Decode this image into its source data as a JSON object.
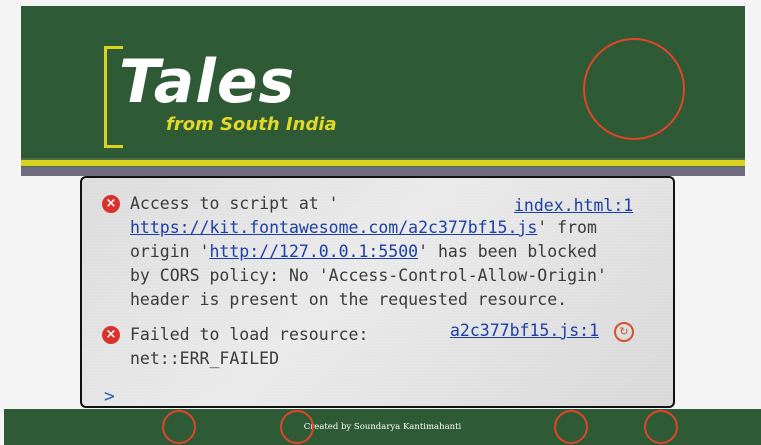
{
  "header": {
    "logo_title": "Tales",
    "logo_subtitle": "from South India"
  },
  "console": {
    "message1": {
      "line1_text": "Access to script at '",
      "source": "index.html:1",
      "url": "https://kit.fontawesome.com/a2c377bf15.js",
      "line2_suffix": "' from",
      "line3_prefix": "origin '",
      "origin": "http://127.0.0.1:5500",
      "line3_suffix": "' has been blocked",
      "line4": "by CORS policy: No 'Access-Control-Allow-Origin'",
      "line5": "header is present on the requested resource."
    },
    "message2": {
      "line1_text": "Failed to load resource:",
      "source": "a2c377bf15.js:1",
      "line2": "net::ERR_FAILED"
    },
    "prompt": ">",
    "error_icon": "error-circle-icon",
    "warning_icon": "swirl-icon"
  },
  "footer": {
    "credit": "Created by Soundarya Kantimahanti"
  },
  "colors": {
    "green": "#2f5a36",
    "yellow": "#d9d31f",
    "annotation_red": "#e0452a",
    "error_red": "#d9322c",
    "link_blue": "#1a3fa6"
  }
}
